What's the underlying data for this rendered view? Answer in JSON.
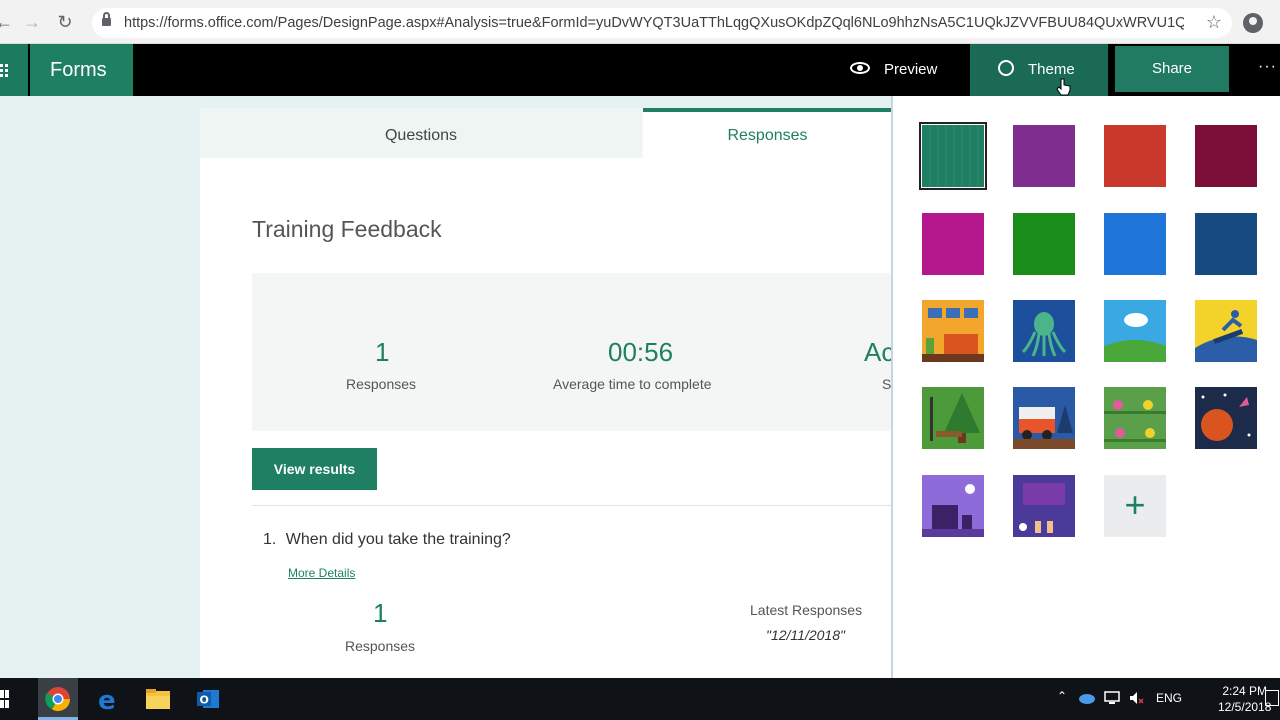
{
  "browser": {
    "url": "https://forms.office.com/Pages/DesignPage.aspx#Analysis=true&FormId=yuDvWYQT3UaTThLqgQXusOKdpZQql6NLo9hhzNsA5C1UQkJZVVFBUU84QUxWRVU1QjF..."
  },
  "header": {
    "app_name": "Forms",
    "preview_label": "Preview",
    "theme_label": "Theme",
    "share_label": "Share"
  },
  "tabs": {
    "questions_label": "Questions",
    "responses_label": "Responses"
  },
  "form": {
    "title": "Training Feedback",
    "stats": [
      {
        "value": "1",
        "label": "Responses"
      },
      {
        "value": "00:56",
        "label": "Average time to complete"
      },
      {
        "value": "Ac",
        "label": "S"
      }
    ],
    "view_results_label": "View results",
    "question": {
      "number": "1.",
      "text": "When did you take the training?",
      "more_details_label": "More Details",
      "responses_count": "1",
      "responses_label": "Responses",
      "latest_title": "Latest Responses",
      "latest_value": "\"12/11/2018\""
    }
  },
  "theme_panel": {
    "colors": [
      "#1f7f63",
      "#7f2d8f",
      "#c8382b",
      "#7b0f3a",
      "#b4188c",
      "#1a8c1a",
      "#1f76d8",
      "#164a80"
    ],
    "add_label": "+"
  },
  "taskbar": {
    "language": "ENG",
    "time": "2:24 PM",
    "date": "12/5/2018"
  }
}
